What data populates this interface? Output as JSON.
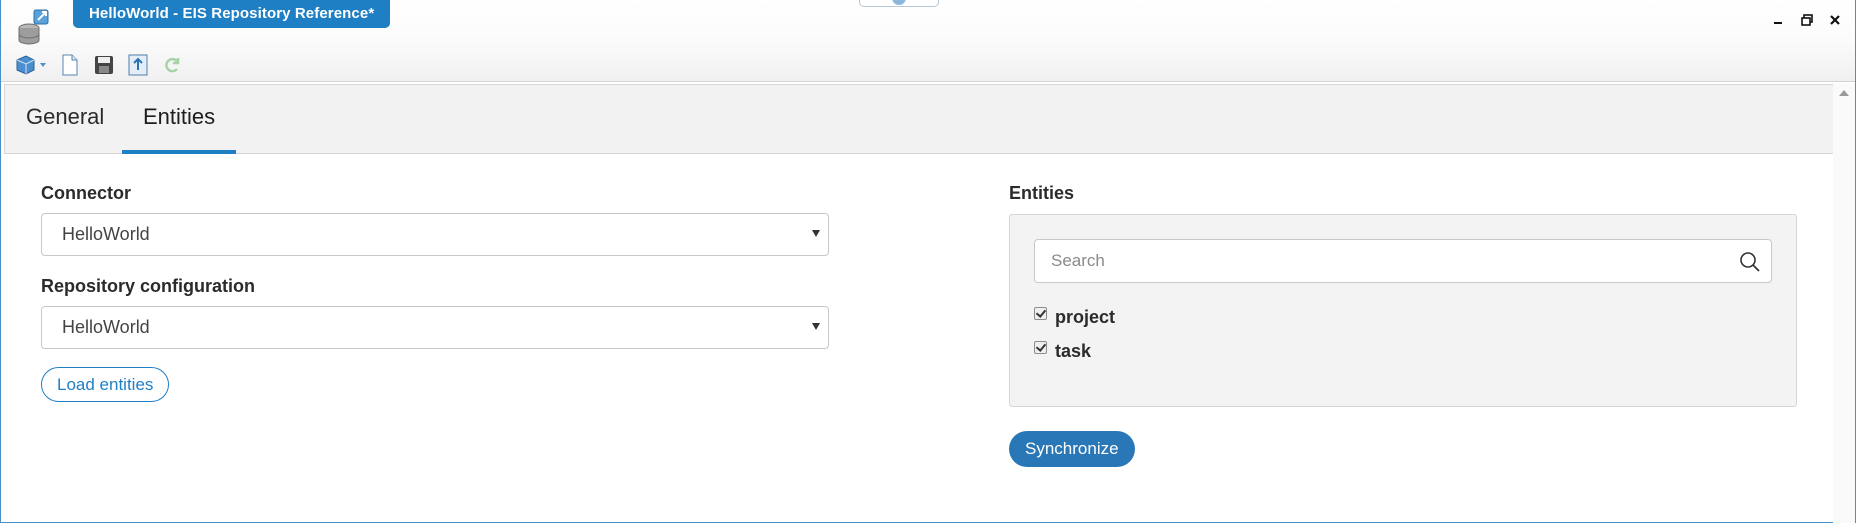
{
  "window": {
    "title": "HelloWorld - EIS Repository Reference*",
    "accent_color": "#1f7fc4"
  },
  "toolbar": {
    "icons": [
      "database-dropdown-icon",
      "new-document-icon",
      "save-icon",
      "export-icon",
      "refresh-icon"
    ]
  },
  "tabs": [
    {
      "label": "General",
      "active": false
    },
    {
      "label": "Entities",
      "active": true
    }
  ],
  "form": {
    "connector_label": "Connector",
    "connector_value": "HelloWorld",
    "repo_config_label": "Repository configuration",
    "repo_config_value": "HelloWorld",
    "load_button": "Load entities"
  },
  "entities": {
    "heading": "Entities",
    "search_placeholder": "Search",
    "items": [
      {
        "label": "project",
        "checked": true
      },
      {
        "label": "task",
        "checked": true
      }
    ],
    "sync_button": "Synchronize"
  }
}
